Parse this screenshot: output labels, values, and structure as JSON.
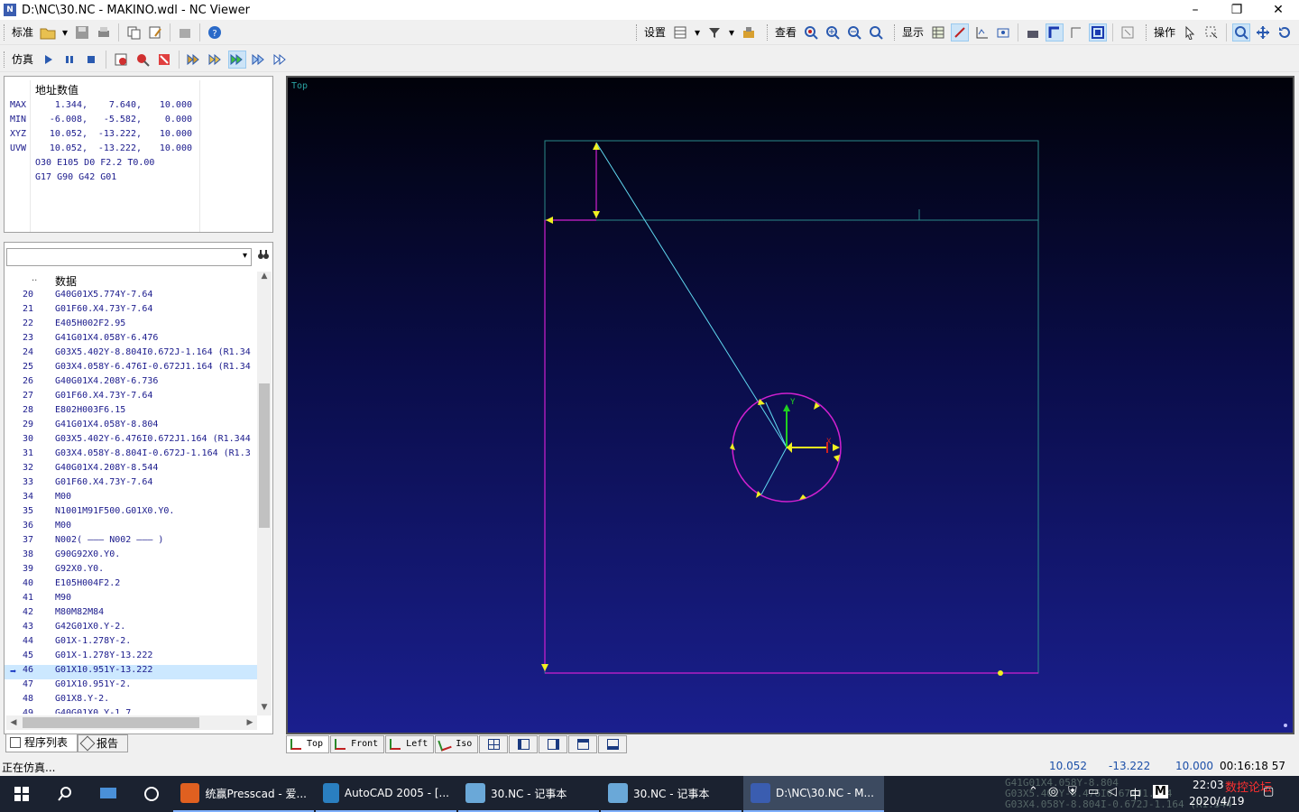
{
  "window": {
    "title": "D:\\NC\\30.NC - MAKINO.wdl - NC Viewer",
    "icon_label": "N",
    "min": "–",
    "max": "❐",
    "close": "✕"
  },
  "toolbar1": {
    "std_label": "标准",
    "settings_label": "设置",
    "view_label": "查看",
    "display_label": "显示",
    "ops_label": "操作"
  },
  "toolbar2": {
    "sim_label": "仿真"
  },
  "address": {
    "header": "地址数值",
    "rows": [
      {
        "label": "MAX",
        "v1": "1.344,",
        "v2": "7.640,",
        "v3": "10.000"
      },
      {
        "label": "MIN",
        "v1": "-6.008,",
        "v2": "-5.582,",
        "v3": "0.000"
      },
      {
        "label": "XYZ",
        "v1": "10.052,",
        "v2": "-13.222,",
        "v3": "10.000"
      },
      {
        "label": "UVW",
        "v1": "10.052,",
        "v2": "-13.222,",
        "v3": "10.000"
      }
    ],
    "line5": "O30 E105 D0 F2.2 T0.00",
    "line6": "G17 G90 G42 G01"
  },
  "program_list": {
    "header_dots": "..",
    "header_data": "数据",
    "current_pointer": "➡",
    "rows": [
      {
        "n": "20",
        "code": "G40G01X5.774Y-7.64"
      },
      {
        "n": "21",
        "code": "G01F60.X4.73Y-7.64"
      },
      {
        "n": "22",
        "code": "E405H002F2.95"
      },
      {
        "n": "23",
        "code": "G41G01X4.058Y-6.476"
      },
      {
        "n": "24",
        "code": "G03X5.402Y-8.804I0.672J-1.164  (R1.34"
      },
      {
        "n": "25",
        "code": "G03X4.058Y-6.476I-0.672J1.164  (R1.34"
      },
      {
        "n": "26",
        "code": "G40G01X4.208Y-6.736"
      },
      {
        "n": "27",
        "code": "G01F60.X4.73Y-7.64"
      },
      {
        "n": "28",
        "code": "E802H003F6.15"
      },
      {
        "n": "29",
        "code": "G41G01X4.058Y-8.804"
      },
      {
        "n": "30",
        "code": "G03X5.402Y-6.476I0.672J1.164  (R1.344"
      },
      {
        "n": "31",
        "code": "G03X4.058Y-8.804I-0.672J-1.164  (R1.3"
      },
      {
        "n": "32",
        "code": "G40G01X4.208Y-8.544"
      },
      {
        "n": "33",
        "code": "G01F60.X4.73Y-7.64"
      },
      {
        "n": "34",
        "code": "M00"
      },
      {
        "n": "35",
        "code": "N1001M91F500.G01X0.Y0."
      },
      {
        "n": "36",
        "code": "M00"
      },
      {
        "n": "37",
        "code": "N002( ——— N002 ——— )"
      },
      {
        "n": "38",
        "code": "G90G92X0.Y0."
      },
      {
        "n": "39",
        "code": "G92X0.Y0."
      },
      {
        "n": "40",
        "code": "E105H004F2.2"
      },
      {
        "n": "41",
        "code": "M90"
      },
      {
        "n": "42",
        "code": "M80M82M84"
      },
      {
        "n": "43",
        "code": "G42G01X0.Y-2."
      },
      {
        "n": "44",
        "code": "G01X-1.278Y-2."
      },
      {
        "n": "45",
        "code": "G01X-1.278Y-13.222"
      },
      {
        "n": "46",
        "code": "G01X10.951Y-13.222",
        "selected": true
      },
      {
        "n": "47",
        "code": "G01X10.951Y-2."
      },
      {
        "n": "48",
        "code": "G01X8.Y-2."
      },
      {
        "n": "49",
        "code": "G40G01X0.Y-1.7"
      }
    ]
  },
  "bottom_tabs": {
    "program_list": "程序列表",
    "report": "报告"
  },
  "viewport": {
    "label": "Top",
    "bg_top": "#01020a",
    "bg_bottom": "#1a1f8e",
    "axis_y": "Y",
    "axis_x": "X"
  },
  "view_tabs": {
    "top": "Top",
    "front": "Front",
    "left": "Left",
    "iso": "Iso"
  },
  "status": {
    "text": "正在仿真...",
    "x": "10.052",
    "y": "-13.222",
    "z": "10.000",
    "time": "00:16:18 57"
  },
  "taskbar": {
    "apps": [
      {
        "label": "统赢Presscad - 爱...",
        "color": "#e06020"
      },
      {
        "label": "AutoCAD 2005 - [...",
        "color": "#2a7fc0"
      },
      {
        "label": "30.NC - 记事本",
        "color": "#6aa8d8"
      },
      {
        "label": "30.NC - 记事本",
        "color": "#6aa8d8"
      },
      {
        "label": "D:\\NC\\30.NC - M...",
        "color": "#3a5db0"
      }
    ],
    "ime": "中",
    "ime_m": "M",
    "time": "22:03",
    "date": "2020/4/19",
    "forum": "数控论坛",
    "ghost1": "G41G01X4.058Y-8.804",
    "ghost2": "G03X5.402Y-6.476I0.672J1.164",
    "ghost3": "G03X4.058Y-8.804I-0.672J-1.164 (R1.344"
  }
}
